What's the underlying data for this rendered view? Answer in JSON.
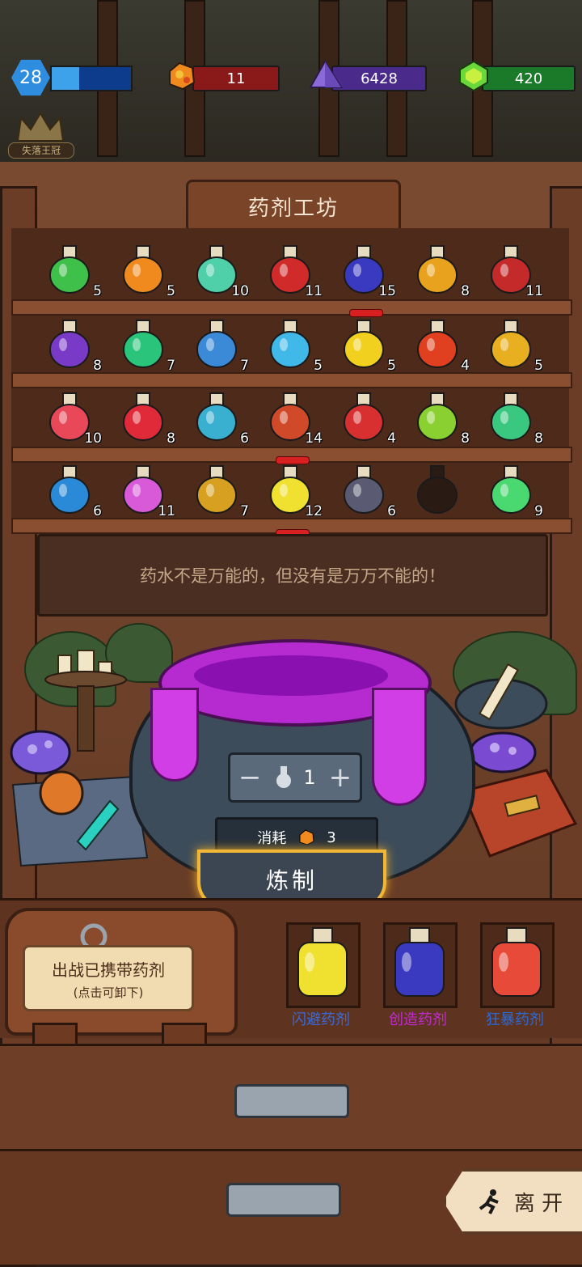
{
  "hud": {
    "level": "28",
    "level_progress": 0.35,
    "resource1": "11",
    "resource2": "6428",
    "resource3": "420",
    "crown_label": "失落王冠"
  },
  "shop": {
    "title": "药剂工坊",
    "message": "药水不是万能的，但没有是万万不能的！"
  },
  "shelves": [
    [
      {
        "count": "5",
        "color": "#3ec04a"
      },
      {
        "count": "5",
        "color": "#f08a1e"
      },
      {
        "count": "10",
        "color": "#4fd0a8"
      },
      {
        "count": "11",
        "color": "#d02a2a"
      },
      {
        "count": "15",
        "color": "#3a3ac0",
        "selected": true
      },
      {
        "count": "8",
        "color": "#e8a21e"
      },
      {
        "count": "11",
        "color": "#c42a2a"
      }
    ],
    [
      {
        "count": "8",
        "color": "#7a3ac8"
      },
      {
        "count": "7",
        "color": "#2ac47a"
      },
      {
        "count": "7",
        "color": "#3a8ad8"
      },
      {
        "count": "5",
        "color": "#40b8e8"
      },
      {
        "count": "5",
        "color": "#f2d020"
      },
      {
        "count": "4",
        "color": "#e04020"
      },
      {
        "count": "5",
        "color": "#e8b020"
      }
    ],
    [
      {
        "count": "10",
        "color": "#e84858"
      },
      {
        "count": "8",
        "color": "#e02a3a"
      },
      {
        "count": "6",
        "color": "#3ab0d0"
      },
      {
        "count": "14",
        "color": "#d04a2a",
        "selected": true
      },
      {
        "count": "4",
        "color": "#d83030"
      },
      {
        "count": "8",
        "color": "#8ad030"
      },
      {
        "count": "8",
        "color": "#3ac880"
      }
    ],
    [
      {
        "count": "6",
        "color": "#2a8ad8"
      },
      {
        "count": "11",
        "color": "#d85ad8"
      },
      {
        "count": "7",
        "color": "#d8a020"
      },
      {
        "count": "12",
        "color": "#f0e030",
        "selected": true
      },
      {
        "count": "6",
        "color": "#5a5a72"
      },
      {
        "count": "",
        "color": "#2a1a14",
        "empty": true
      },
      {
        "count": "9",
        "color": "#4ad870"
      }
    ]
  ],
  "cauldron": {
    "minus": "−",
    "plus": "+",
    "quantity": "1",
    "cost_label": "消耗",
    "cost_value": "3",
    "craft_label": "炼制"
  },
  "carried": {
    "bag_label_line1": "出战已携带药剂",
    "bag_label_line2": "(点击可卸下)",
    "slots": [
      {
        "name": "闪避药剂",
        "color": "#f0e030",
        "text_color": "#3a6ad8"
      },
      {
        "name": "创造药剂",
        "color": "#3a3ac0",
        "text_color": "#c02ad0"
      },
      {
        "name": "狂暴药剂",
        "color": "#e84a3a",
        "text_color": "#2a6ad8"
      }
    ]
  },
  "leave_label": "离 开"
}
